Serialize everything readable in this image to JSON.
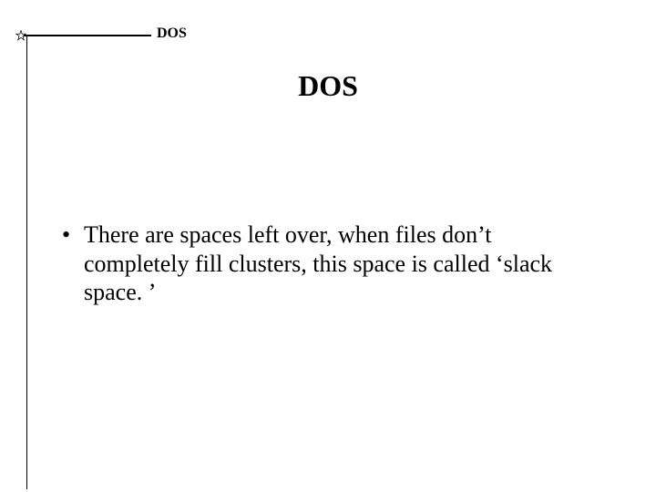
{
  "header": {
    "label": "DOS"
  },
  "title": "DOS",
  "bullets": [
    {
      "text": "There are spaces left over, when files don’t completely fill clusters, this space is called ‘slack space. ’"
    }
  ]
}
